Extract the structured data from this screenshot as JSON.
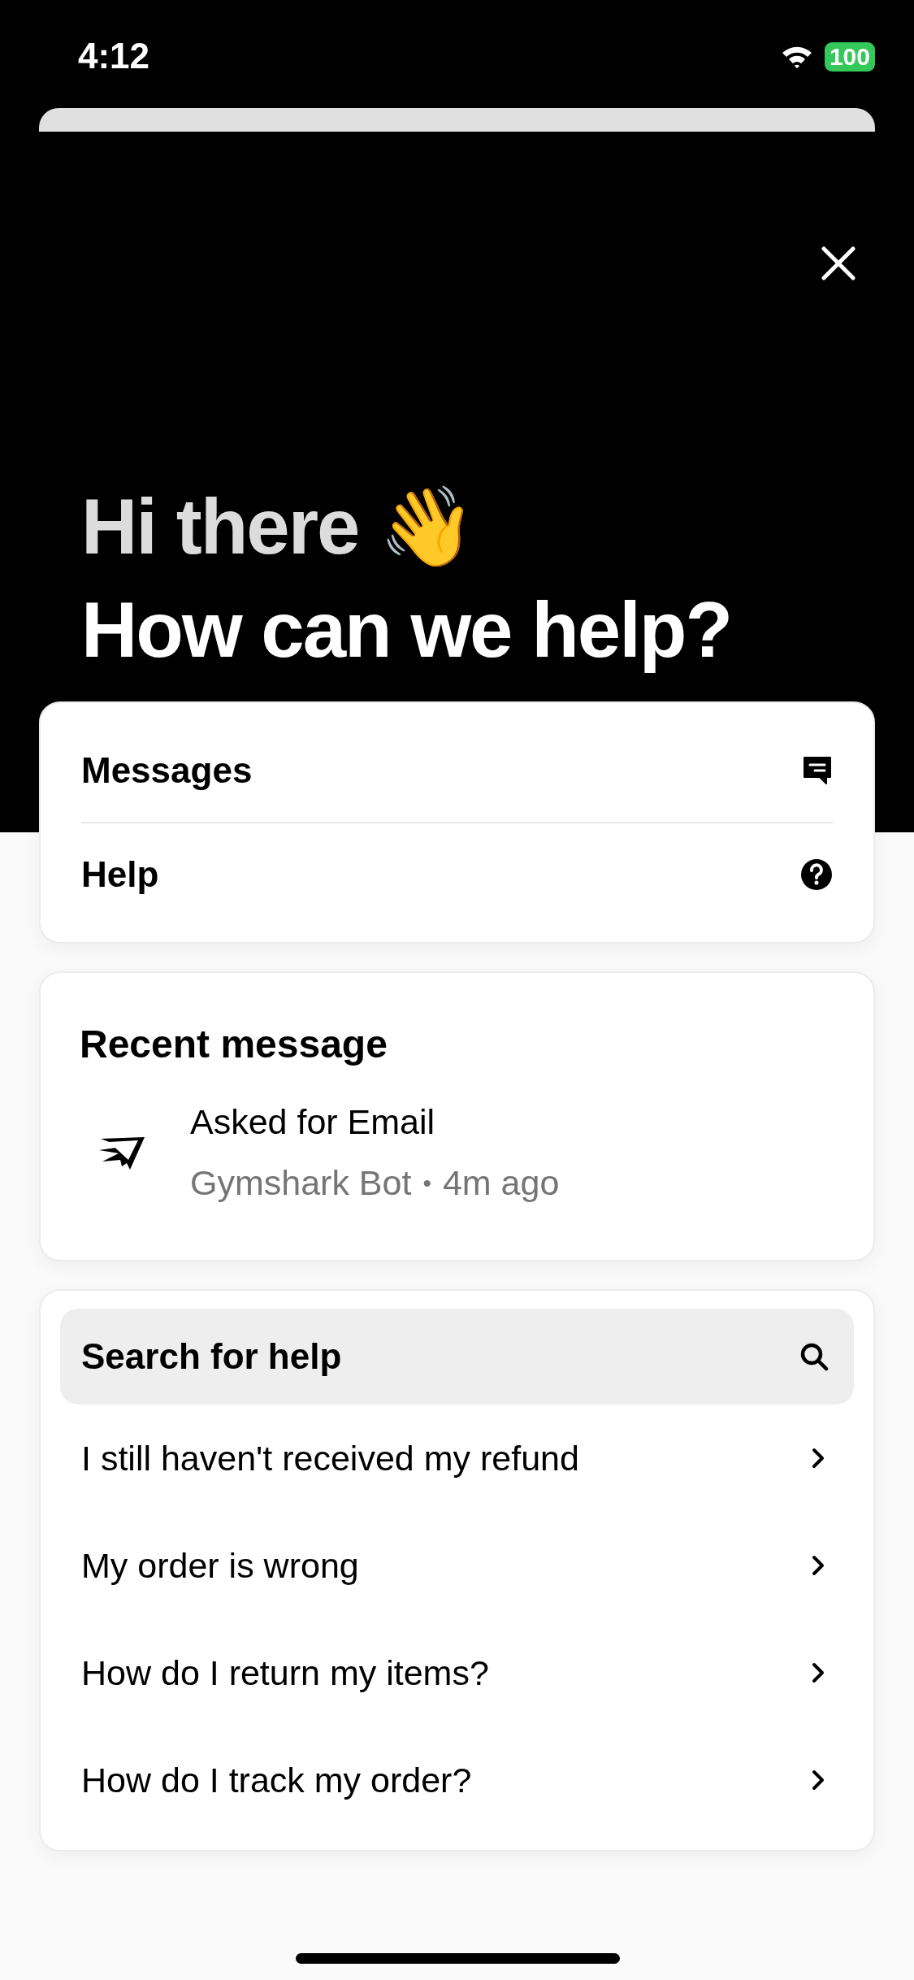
{
  "status_bar": {
    "time": "4:12",
    "battery": "100"
  },
  "greeting": {
    "line1": "Hi there 👋",
    "line2": "How can we help?"
  },
  "nav": [
    {
      "label": "Messages",
      "kind": "messages"
    },
    {
      "label": "Help",
      "kind": "help"
    }
  ],
  "recent": {
    "title": "Recent message",
    "message": "Asked for Email",
    "sender": "Gymshark Bot",
    "separator": "•",
    "time": "4m ago"
  },
  "help": {
    "search": {
      "placeholder": "Search for help"
    },
    "articles": [
      "I still haven't received my refund",
      "My order is wrong",
      "How do I return my items?",
      "How do I track my order?"
    ]
  }
}
